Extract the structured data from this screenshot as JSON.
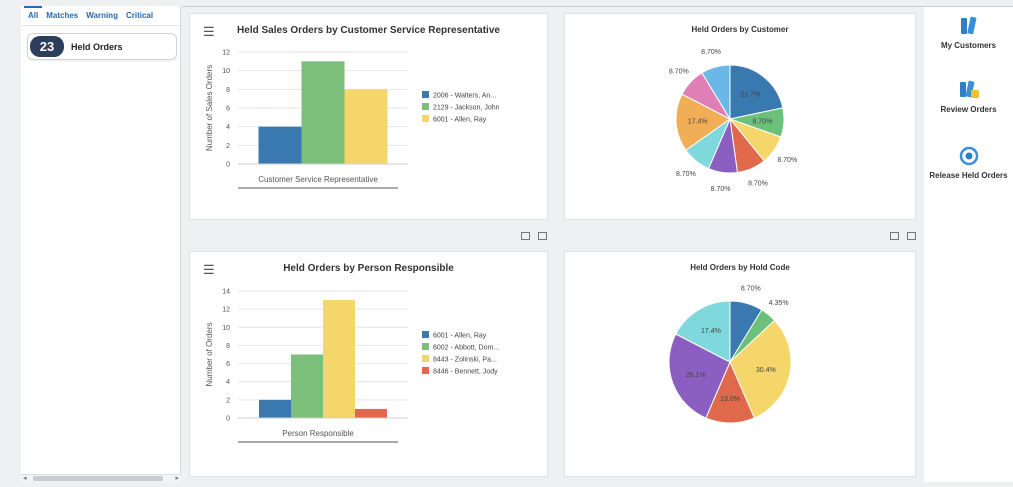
{
  "watchlist": {
    "tabs": [
      {
        "label": "All",
        "active": true
      },
      {
        "label": "Matches",
        "active": false
      },
      {
        "label": "Warning",
        "active": false
      },
      {
        "label": "Critical",
        "active": false
      }
    ],
    "item": {
      "count": "23",
      "label": "Held Orders"
    }
  },
  "actions": [
    {
      "label": "My Customers",
      "icon": "books-icon"
    },
    {
      "label": "Review Orders",
      "icon": "review-orders-icon"
    },
    {
      "label": "Release Held Orders",
      "icon": "release-target-icon"
    }
  ],
  "colors": {
    "blue": "#3a78b0",
    "green": "#7cbf7b",
    "yellow": "#f4d66b",
    "orange": "#e0694b"
  },
  "chart_data": [
    {
      "type": "bar",
      "title": "Held Sales Orders by Customer Service Representative",
      "xlabel": "Customer Service Representative",
      "ylabel": "Number of Sales Orders",
      "ylim": [
        0,
        12
      ],
      "yticks": [
        0,
        2,
        4,
        6,
        8,
        10,
        12
      ],
      "grid": true,
      "legend_position": "right",
      "series": [
        {
          "name": "2006 - Walters, An...",
          "value": 4,
          "color": "#3a78b0"
        },
        {
          "name": "2129 - Jackson, John",
          "value": 11,
          "color": "#7cbf7b"
        },
        {
          "name": "6001 - Allen, Ray",
          "value": 8,
          "color": "#f4d66b"
        }
      ]
    },
    {
      "type": "pie",
      "title": "Held Orders by Customer",
      "slices": [
        {
          "value": 21.7,
          "label": "21.7%",
          "color": "#3a78b0"
        },
        {
          "value": 8.7,
          "label": "8.70%",
          "color": "#6cc17a"
        },
        {
          "value": 8.7,
          "label": "8.70%",
          "color": "#f4d66b"
        },
        {
          "value": 8.7,
          "label": "8.70%",
          "color": "#e0694b"
        },
        {
          "value": 8.7,
          "label": "8.70%",
          "color": "#8a5fc1"
        },
        {
          "value": 8.7,
          "label": "8.70%",
          "color": "#7fd8dc"
        },
        {
          "value": 17.4,
          "label": "17.4%",
          "color": "#f2ad57"
        },
        {
          "value": 8.7,
          "label": "8.70%",
          "color": "#e07fb6"
        },
        {
          "value": 8.7,
          "label": "8.70%",
          "color": "#6ab8e8"
        }
      ]
    },
    {
      "type": "bar",
      "title": "Held Orders by Person Responsible",
      "xlabel": "Person Responsible",
      "ylabel": "Number of Orders",
      "ylim": [
        0,
        14
      ],
      "yticks": [
        0,
        2,
        4,
        6,
        8,
        10,
        12,
        14
      ],
      "grid": true,
      "legend_position": "right",
      "series": [
        {
          "name": "6001 - Allen, Ray",
          "value": 2,
          "color": "#3a78b0"
        },
        {
          "name": "6002 - Abbott, Dom...",
          "value": 7,
          "color": "#7cbf7b"
        },
        {
          "name": "8443 - Zolinski, Pa...",
          "value": 13,
          "color": "#f4d66b"
        },
        {
          "name": "8446 - Bennett, Jody",
          "value": 1,
          "color": "#e0694b"
        }
      ]
    },
    {
      "type": "pie",
      "title": "Held Orders by Hold Code",
      "slices": [
        {
          "value": 8.7,
          "label": "8.70%",
          "color": "#3a78b0"
        },
        {
          "value": 4.35,
          "label": "4.35%",
          "color": "#6cc17a"
        },
        {
          "value": 30.4,
          "label": "30.4%",
          "color": "#f4d66b"
        },
        {
          "value": 13.0,
          "label": "13.0%",
          "color": "#e0694b"
        },
        {
          "value": 26.1,
          "label": "26.1%",
          "color": "#8a5fc1"
        },
        {
          "value": 17.4,
          "label": "17.4%",
          "color": "#7fd8dc"
        }
      ]
    }
  ]
}
